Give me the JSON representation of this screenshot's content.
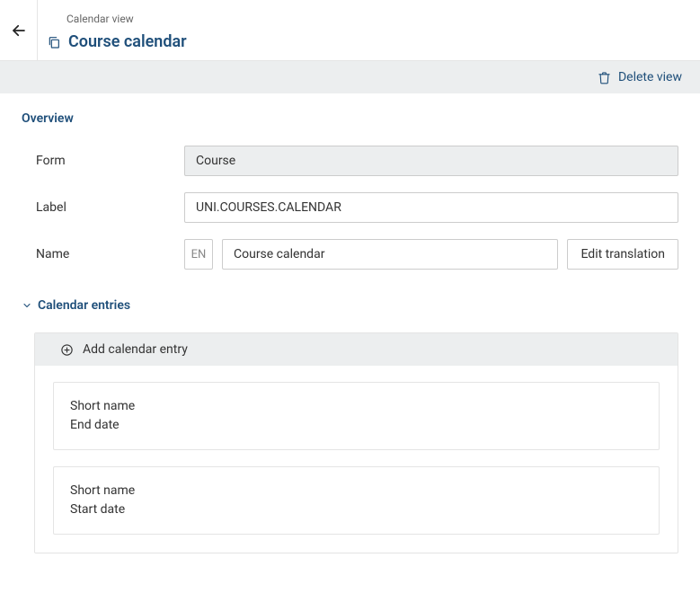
{
  "breadcrumb": "Calendar view",
  "page_title": "Course calendar",
  "toolbar": {
    "delete_view_label": "Delete view"
  },
  "overview": {
    "section_title": "Overview",
    "labels": {
      "form": "Form",
      "label": "Label",
      "name": "Name"
    },
    "form_value": "Course",
    "label_value": "UNI.COURSES.CALENDAR",
    "name_lang": "EN",
    "name_value": "Course calendar",
    "edit_translation_label": "Edit translation"
  },
  "calendar_entries": {
    "section_title": "Calendar entries",
    "add_entry_label": "Add calendar entry",
    "entries": [
      {
        "line1": "Short name",
        "line2": "End date"
      },
      {
        "line1": "Short name",
        "line2": "Start date"
      }
    ]
  }
}
